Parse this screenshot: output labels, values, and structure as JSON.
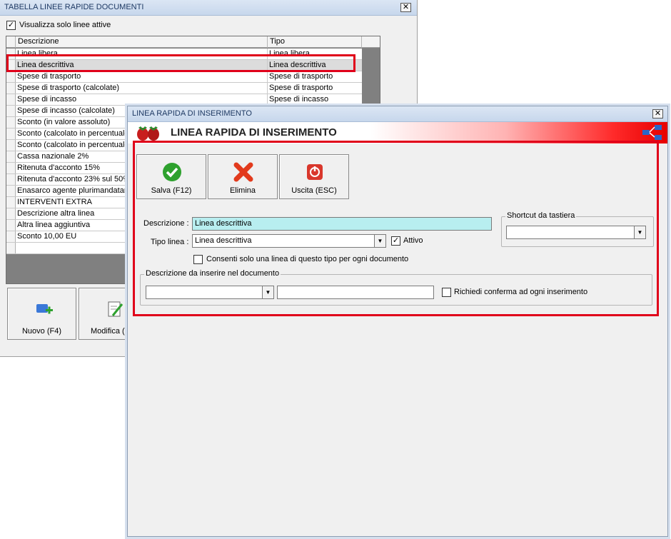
{
  "back_window": {
    "title": "TABELLA LINEE RAPIDE DOCUMENTI",
    "close_glyph": "✕",
    "active_only_checked": true,
    "active_only_label": "Visualizza solo linee attive",
    "columns": [
      "Descrizione",
      "Tipo"
    ],
    "rows": [
      {
        "descrizione": "Linea libera",
        "tipo": "Linea libera"
      },
      {
        "descrizione": "Linea descrittiva",
        "tipo": "Linea descrittiva"
      },
      {
        "descrizione": "Spese di trasporto",
        "tipo": "Spese di trasporto"
      },
      {
        "descrizione": "Spese di trasporto (calcolate)",
        "tipo": "Spese di trasporto"
      },
      {
        "descrizione": "Spese di incasso",
        "tipo": "Spese di incasso"
      },
      {
        "descrizione": "Spese di incasso (calcolate)",
        "tipo": ""
      },
      {
        "descrizione": "Sconto (in valore assoluto)",
        "tipo": ""
      },
      {
        "descrizione": "Sconto (calcolato in percentuale",
        "tipo": ""
      },
      {
        "descrizione": "Sconto (calcolato in percentuale",
        "tipo": ""
      },
      {
        "descrizione": "Cassa nazionale 2%",
        "tipo": ""
      },
      {
        "descrizione": "Ritenuta d'acconto 15%",
        "tipo": ""
      },
      {
        "descrizione": "Ritenuta d'acconto 23% sul 50%",
        "tipo": ""
      },
      {
        "descrizione": "Enasarco agente plurimandatari",
        "tipo": ""
      },
      {
        "descrizione": "INTERVENTI EXTRA",
        "tipo": ""
      },
      {
        "descrizione": "Descrizione altra linea",
        "tipo": ""
      },
      {
        "descrizione": "Altra linea aggiuntiva",
        "tipo": ""
      },
      {
        "descrizione": "Sconto 10,00 EU",
        "tipo": ""
      },
      {
        "descrizione": "",
        "tipo": ""
      }
    ],
    "selected_row": 1,
    "new_button": "Nuovo (F4)",
    "edit_button": "Modifica (F"
  },
  "front_window": {
    "title": "LINEA RAPIDA DI INSERIMENTO",
    "banner_title": "LINEA RAPIDA DI INSERIMENTO",
    "close_glyph": "✕",
    "buttons": {
      "save": "Salva (F12)",
      "delete": "Elimina",
      "exit": "Uscita (ESC)"
    },
    "form": {
      "description_label": "Descrizione :",
      "description_value": "Linea descrittiva",
      "type_label": "Tipo linea :",
      "type_value": "Linea descrittiva",
      "active_label": "Attivo",
      "active_checked": true,
      "one_per_doc_label": "Consenti solo una linea di questo tipo per ogni documento",
      "one_per_doc_checked": false,
      "shortcut_group": "Shortcut da tastiera",
      "shortcut_value": "",
      "doc_desc_group": "Descrizione da inserire nel documento",
      "doc_desc_combo_value": "",
      "doc_desc_text_value": "",
      "confirm_label": "Richiedi conferma ad ogni inserimento",
      "confirm_checked": false
    }
  },
  "colors": {
    "highlight_frame": "#e0001a",
    "description_bg": "#b8eef0",
    "save_icon": "#2ea12e",
    "delete_icon": "#e23a1c",
    "exit_icon": "#d9372c"
  }
}
